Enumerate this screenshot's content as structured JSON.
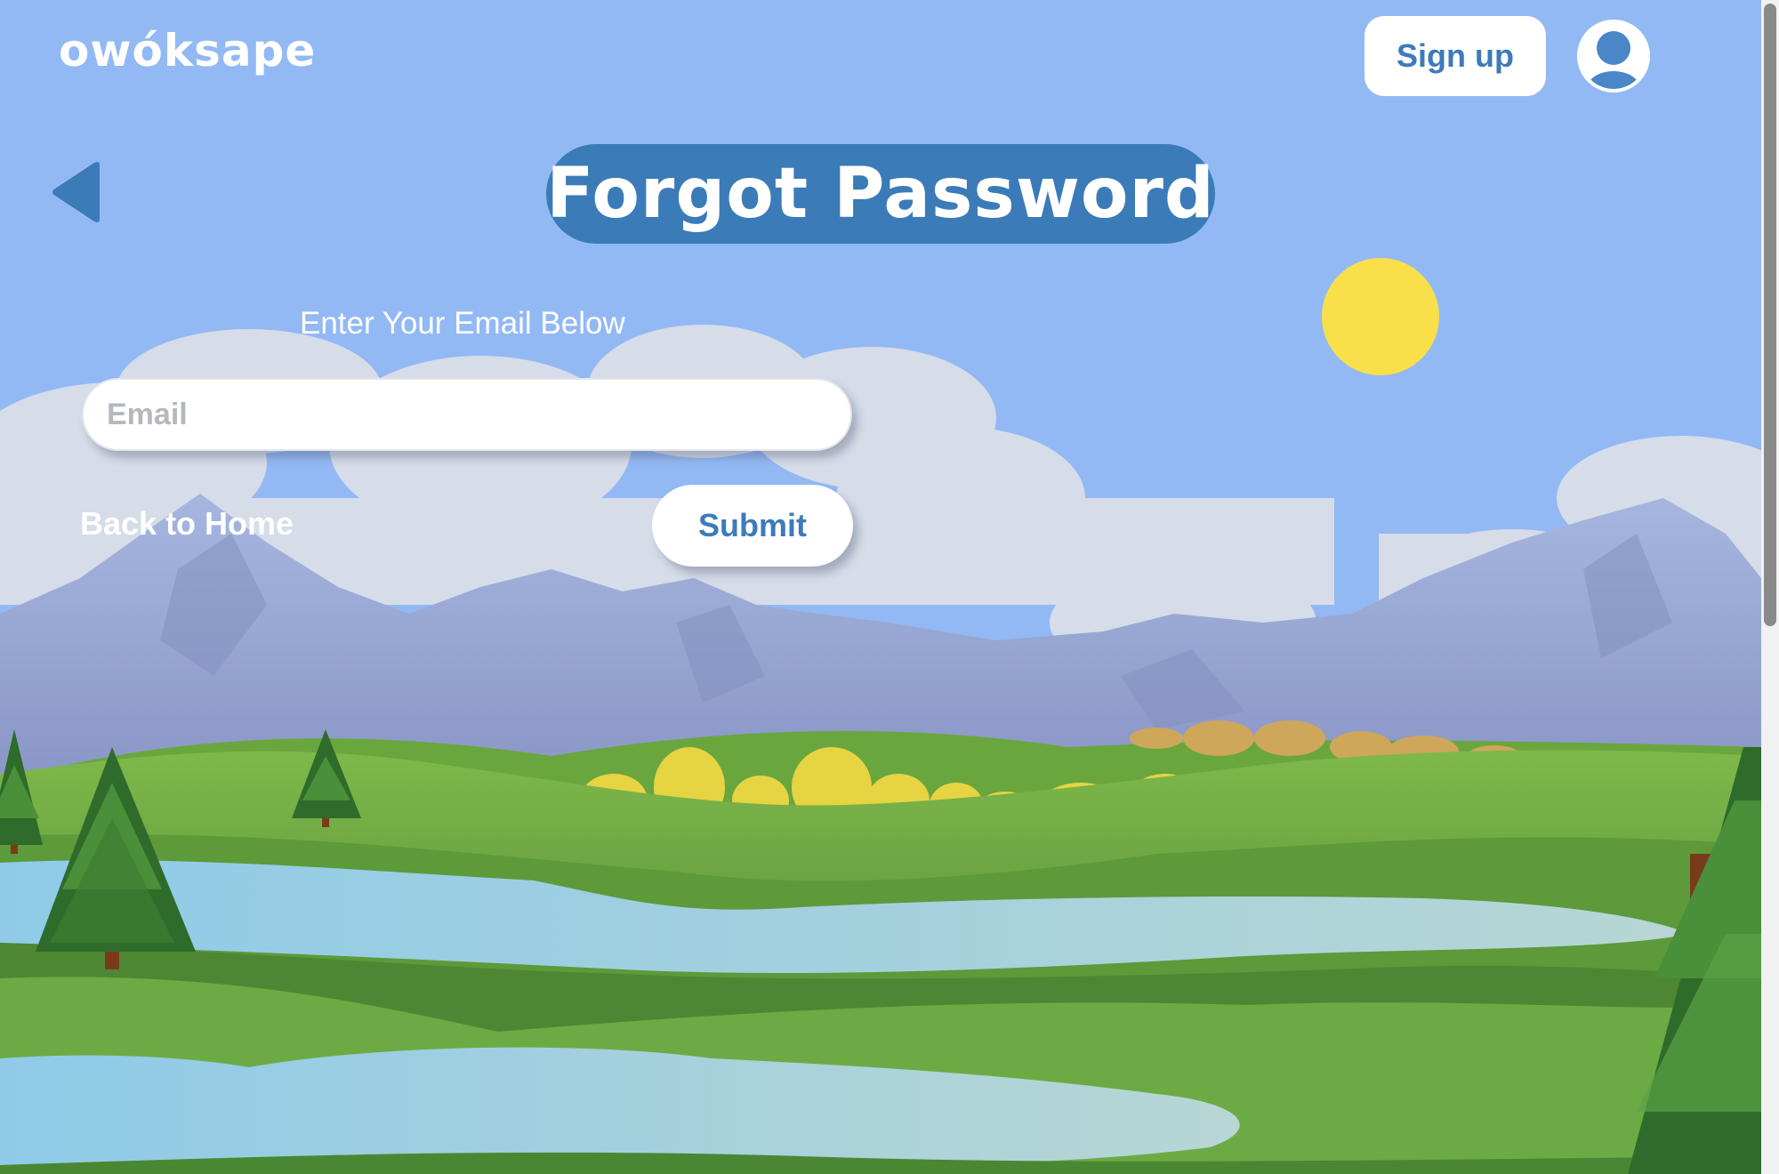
{
  "header": {
    "brand": "owóksape",
    "signup_label": "Sign up",
    "avatar_icon": "user-icon"
  },
  "page": {
    "back_icon": "back-arrow-icon",
    "title": "Forgot Password",
    "instruction": "Enter Your Email Below"
  },
  "form": {
    "email_placeholder": "Email",
    "email_value": "",
    "back_home_label": "Back to Home",
    "submit_label": "Submit"
  },
  "colors": {
    "sky": "#93b9f4",
    "accent_blue": "#3b7bb8",
    "sun": "#f9e04b",
    "grass": "#4f8a36",
    "lake": "#8ec9e6",
    "mountains": "#9aaad4"
  }
}
